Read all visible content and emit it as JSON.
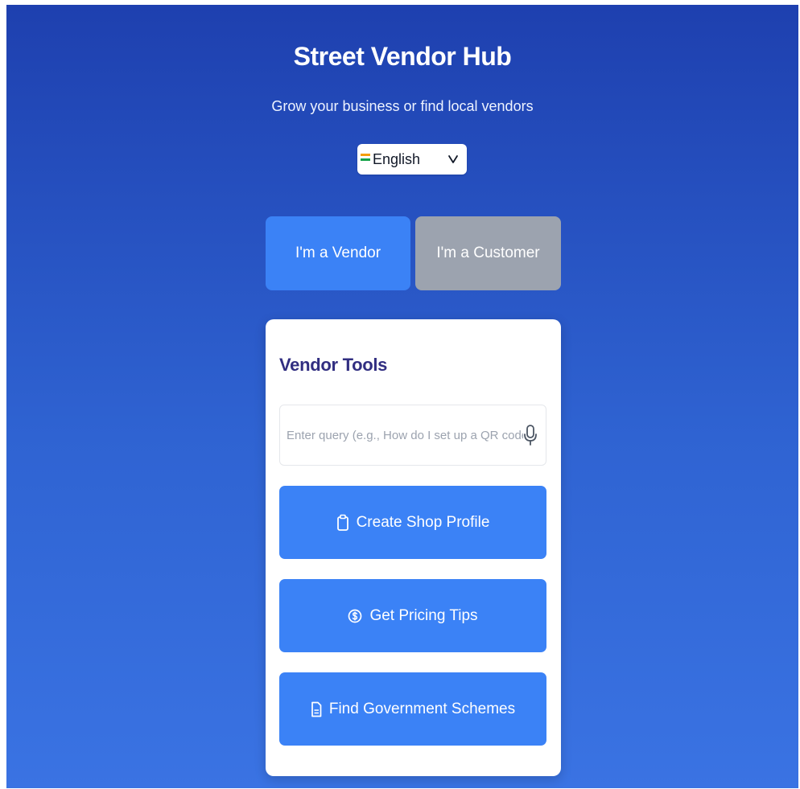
{
  "app": {
    "title": "Street Vendor Hub",
    "subtitle": "Grow your business or find local vendors"
  },
  "language": {
    "selected": "English",
    "flag_icon": "india-flag-icon",
    "chevron_icon": "chevron-down-icon"
  },
  "roles": {
    "vendor_label": "I'm a Vendor",
    "customer_label": "I'm a Customer",
    "active": "vendor"
  },
  "vendor_tools": {
    "title": "Vendor Tools",
    "query": {
      "value": "",
      "placeholder": "Enter query (e.g., How do I set up a QR code?)",
      "icon": "microphone-icon"
    },
    "buttons": [
      {
        "label": "Create Shop Profile",
        "icon": "clipboard-icon"
      },
      {
        "label": "Get Pricing Tips",
        "icon": "dollar-circle-icon"
      },
      {
        "label": "Find Government Schemes",
        "icon": "document-icon"
      }
    ]
  },
  "colors": {
    "background_top": "#1e40af",
    "background_bottom": "#3a73e3",
    "primary_button": "#3b82f6",
    "inactive_button": "#9ca3af",
    "card_title": "#312e81"
  }
}
